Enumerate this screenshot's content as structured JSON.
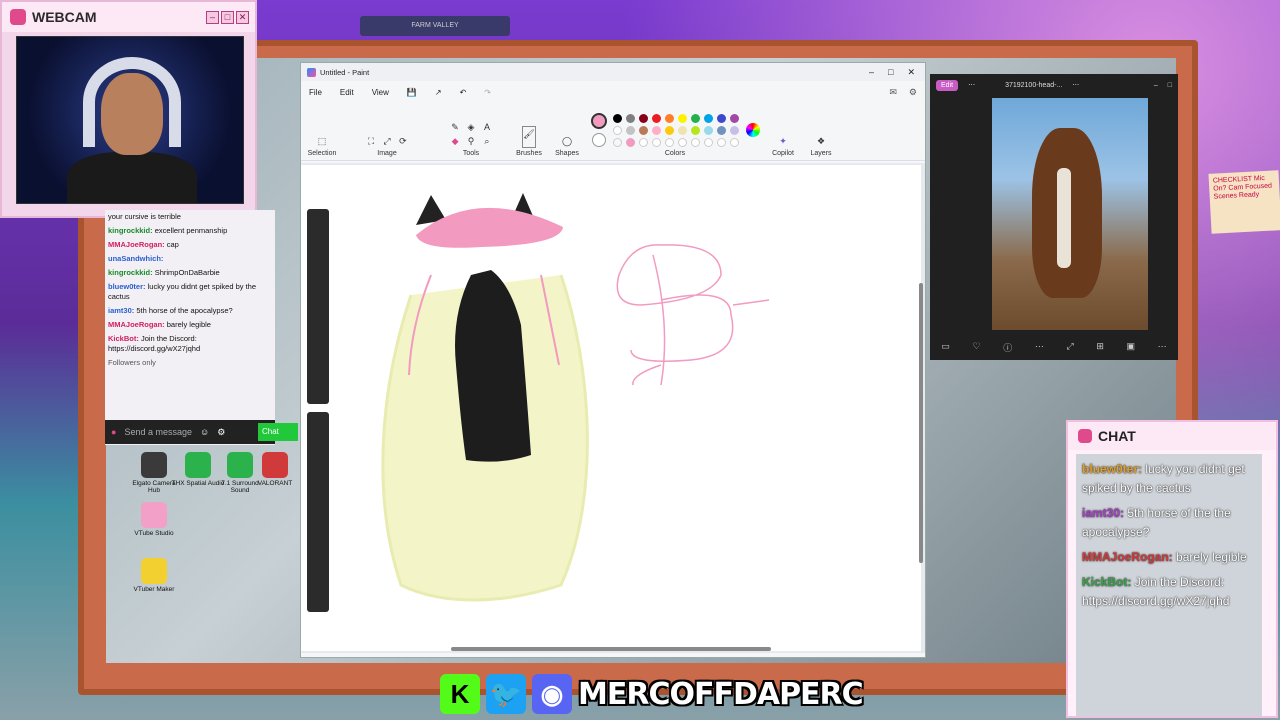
{
  "webcam": {
    "title": "WEBCAM",
    "controls": [
      "–",
      "□",
      "✕"
    ]
  },
  "left_chat": {
    "messages": [
      {
        "user": "",
        "text": "your cursive is terrible",
        "cls": "u1"
      },
      {
        "user": "kingrockkid:",
        "text": "excellent penmanship",
        "cls": "u2"
      },
      {
        "user": "MMAJoeRogan:",
        "text": "cap",
        "cls": "u1"
      },
      {
        "user": "unaSandwhich:",
        "text": "",
        "cls": "u3"
      },
      {
        "user": "kingrockkid:",
        "text": "ShrimpOnDaBarbie",
        "cls": "u2"
      },
      {
        "user": "bluew0ter:",
        "text": "lucky you didnt get spiked by the cactus",
        "cls": "u3"
      },
      {
        "user": "iamt30:",
        "text": "5th horse of the apocalypse?",
        "cls": "u3"
      },
      {
        "user": "MMAJoeRogan:",
        "text": "barely legible",
        "cls": "u1"
      },
      {
        "user": "KickBot:",
        "text": "Join the Discord: https://discord.gg/wX27jqhd",
        "cls": "u1"
      }
    ],
    "followers_only": "Followers only",
    "send_placeholder": "Send a message",
    "chat_button": "Chat"
  },
  "desktop_icons": [
    {
      "label": "Elgato Camera Hub",
      "color": "#3a3a3a"
    },
    {
      "label": "THX Spatial Audio",
      "color": "#2bb24c"
    },
    {
      "label": "7.1 Surround Sound",
      "color": "#2bb24c"
    },
    {
      "label": "VALORANT",
      "color": "#d03a3a"
    },
    {
      "label": "VTube Studio",
      "color": "#f2a0c8"
    },
    {
      "label": "VTuber Maker",
      "color": "#f2d030"
    }
  ],
  "paint": {
    "title": "Untitled - Paint",
    "menu": [
      "File",
      "Edit",
      "View"
    ],
    "groups": {
      "selection": "Selection",
      "image": "Image",
      "tools": "Tools",
      "brushes": "Brushes",
      "shapes": "Shapes",
      "colors": "Colors",
      "copilot": "Copilot",
      "layers": "Layers"
    },
    "active_color": "#f29ac0",
    "palette": [
      "#000000",
      "#7f7f7f",
      "#880015",
      "#ed1c24",
      "#ff7f27",
      "#fff200",
      "#22b14c",
      "#00a2e8",
      "#3f48cc",
      "#a349a4",
      "#ffffff",
      "#c3c3c3",
      "#b97a57",
      "#ffaec9",
      "#ffc90e",
      "#efe4b0",
      "#b5e61d",
      "#99d9ea",
      "#7092be",
      "#c8bfe7",
      "#f7f7f7",
      "#f29ac0",
      "#ffffff",
      "#ffffff",
      "#ffffff",
      "#ffffff",
      "#ffffff",
      "#ffffff",
      "#ffffff",
      "#ffffff"
    ],
    "canvas_text": "Bax"
  },
  "photos": {
    "edit": "Edit",
    "filename": "37192100-head-..."
  },
  "note": {
    "text": "CHECKLIST Mic On? Cam Focused Scenes Ready"
  },
  "chat": {
    "title": "CHAT",
    "messages": [
      {
        "user": "bluew0ter:",
        "text": "lucky you didnt get spiked by the cactus",
        "cls": "un-a"
      },
      {
        "user": "iamt30:",
        "text": "5th horse of the the apocalypse?",
        "cls": "un-b"
      },
      {
        "user": "MMAJoeRogan:",
        "text": "barely legible",
        "cls": "un-c"
      },
      {
        "user": "KickBot:",
        "text": "Join the Discord: https://discord.gg/wX27jqhd",
        "cls": "un-d"
      }
    ]
  },
  "brand": {
    "name": "MERCOFFDAPERC",
    "kick": "K",
    "twitter": "🐦",
    "discord": "◉"
  },
  "deco": {
    "banner": "FARM VALLEY"
  }
}
